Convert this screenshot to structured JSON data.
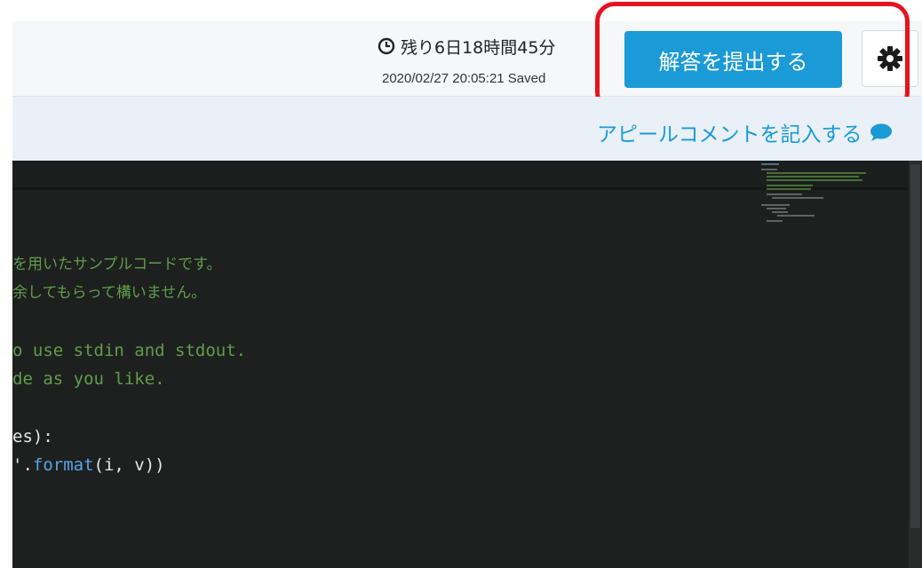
{
  "header": {
    "timer_text": "残り6日18時間45分",
    "saved_text": "2020/02/27 20:05:21 Saved",
    "submit_label": "解答を提出する",
    "settings_icon": "gear-icon",
    "timer_icon": "clock-icon"
  },
  "appeal": {
    "link_label": "アピールコメントを記入する",
    "icon": "chat-bubble-icon"
  },
  "editor": {
    "lines": [
      {
        "text": "を用いたサンプルコードです。",
        "kind": "comment-jp"
      },
      {
        "text": "余してもらって構いません。",
        "kind": "comment-jp"
      },
      {
        "text": "o use stdin and stdout.",
        "kind": "comment"
      },
      {
        "text": "de as you like.",
        "kind": "comment"
      },
      {
        "text": "es):",
        "kind": "plain"
      },
      {
        "text_prefix": "'.",
        "text_fn": "format",
        "text_suffix": "(i, v))",
        "kind": "mixed"
      }
    ]
  },
  "colors": {
    "accent": "#1a9ad6",
    "highlight": "#e5131d",
    "editor_bg": "#1e1f1f",
    "comment": "#5f9e4a"
  }
}
